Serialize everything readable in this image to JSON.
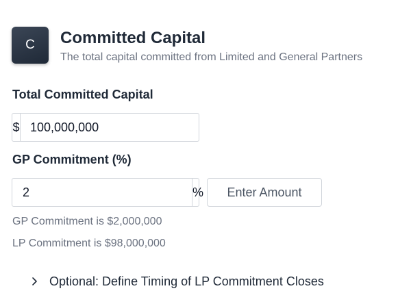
{
  "header": {
    "avatar_letter": "C",
    "title": "Committed Capital",
    "subtitle": "The total capital committed from Limited and General Partners"
  },
  "total_capital": {
    "label": "Total Committed Capital",
    "prefix": "$",
    "value": "100,000,000"
  },
  "gp_commitment": {
    "label": "GP Commitment (%)",
    "value": "2",
    "suffix": "%",
    "enter_amount_label": "Enter Amount"
  },
  "summary": {
    "gp_text": "GP Commitment is $2,000,000",
    "lp_text": "LP Commitment is $98,000,000"
  },
  "optional_section": {
    "icon": "chevron-right-icon",
    "label": "Optional: Define Timing of LP Commitment Closes",
    "expanded": false
  },
  "colors": {
    "avatar_bg": "#2d3644",
    "text_primary": "#1f2937",
    "text_muted": "#6b7280",
    "border": "#d1d5db"
  }
}
